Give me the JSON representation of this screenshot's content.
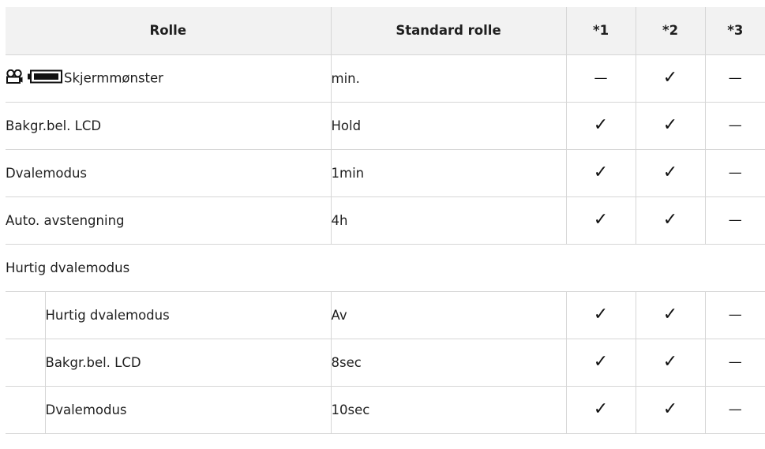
{
  "headers": {
    "role": "Rolle",
    "default_role": "Standard rolle",
    "col1": "*1",
    "col2": "*2",
    "col3": "*3"
  },
  "rows": [
    {
      "label": "Skjermmønster",
      "default": "min.",
      "c1": "—",
      "c2": "✓",
      "c3": "—",
      "icons": [
        "movie-icon",
        "battery-icon"
      ]
    },
    {
      "label": "Bakgr.bel. LCD",
      "default": "Hold",
      "c1": "✓",
      "c2": "✓",
      "c3": "—"
    },
    {
      "label": "Dvalemodus",
      "default": "1min",
      "c1": "✓",
      "c2": "✓",
      "c3": "—"
    },
    {
      "label": "Auto. avstengning",
      "default": "4h",
      "c1": "✓",
      "c2": "✓",
      "c3": "—"
    }
  ],
  "group": {
    "label": "Hurtig dvalemodus",
    "rows": [
      {
        "label": "Hurtig dvalemodus",
        "default": "Av",
        "c1": "✓",
        "c2": "✓",
        "c3": "—"
      },
      {
        "label": "Bakgr.bel. LCD",
        "default": "8sec",
        "c1": "✓",
        "c2": "✓",
        "c3": "—"
      },
      {
        "label": "Dvalemodus",
        "default": "10sec",
        "c1": "✓",
        "c2": "✓",
        "c3": "—"
      }
    ]
  }
}
